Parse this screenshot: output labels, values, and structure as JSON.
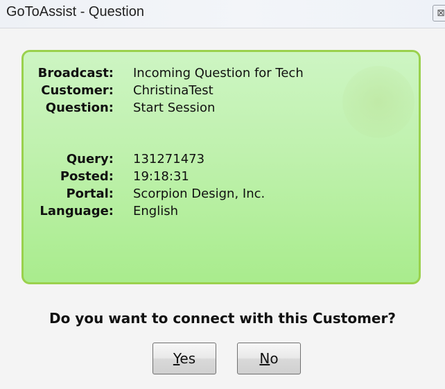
{
  "window": {
    "title": "GoToAssist - Question",
    "close_glyph": "⊠"
  },
  "details": [
    {
      "label": "Broadcast:",
      "value": "Incoming Question for Tech"
    },
    {
      "label": "Customer:",
      "value": "ChristinaTest"
    },
    {
      "label": "Question:",
      "value": "Start Session"
    },
    {
      "label": "Query:",
      "value": "131271473"
    },
    {
      "label": "Posted:",
      "value": "19:18:31"
    },
    {
      "label": "Portal:",
      "value": "Scorpion Design, Inc."
    },
    {
      "label": "Language:",
      "value": "English"
    }
  ],
  "prompt": "Do you want to connect with this Customer?",
  "buttons": {
    "yes": {
      "mnemonic": "Y",
      "rest": "es"
    },
    "no": {
      "mnemonic": "N",
      "rest": "o"
    }
  },
  "colors": {
    "panel_border": "#9ad14d",
    "panel_fill_top": "#cdf5c3",
    "panel_fill_bottom": "#a9ec8d"
  },
  "icons": {
    "close": "close-icon",
    "watermark": "helmet-watermark-icon"
  }
}
